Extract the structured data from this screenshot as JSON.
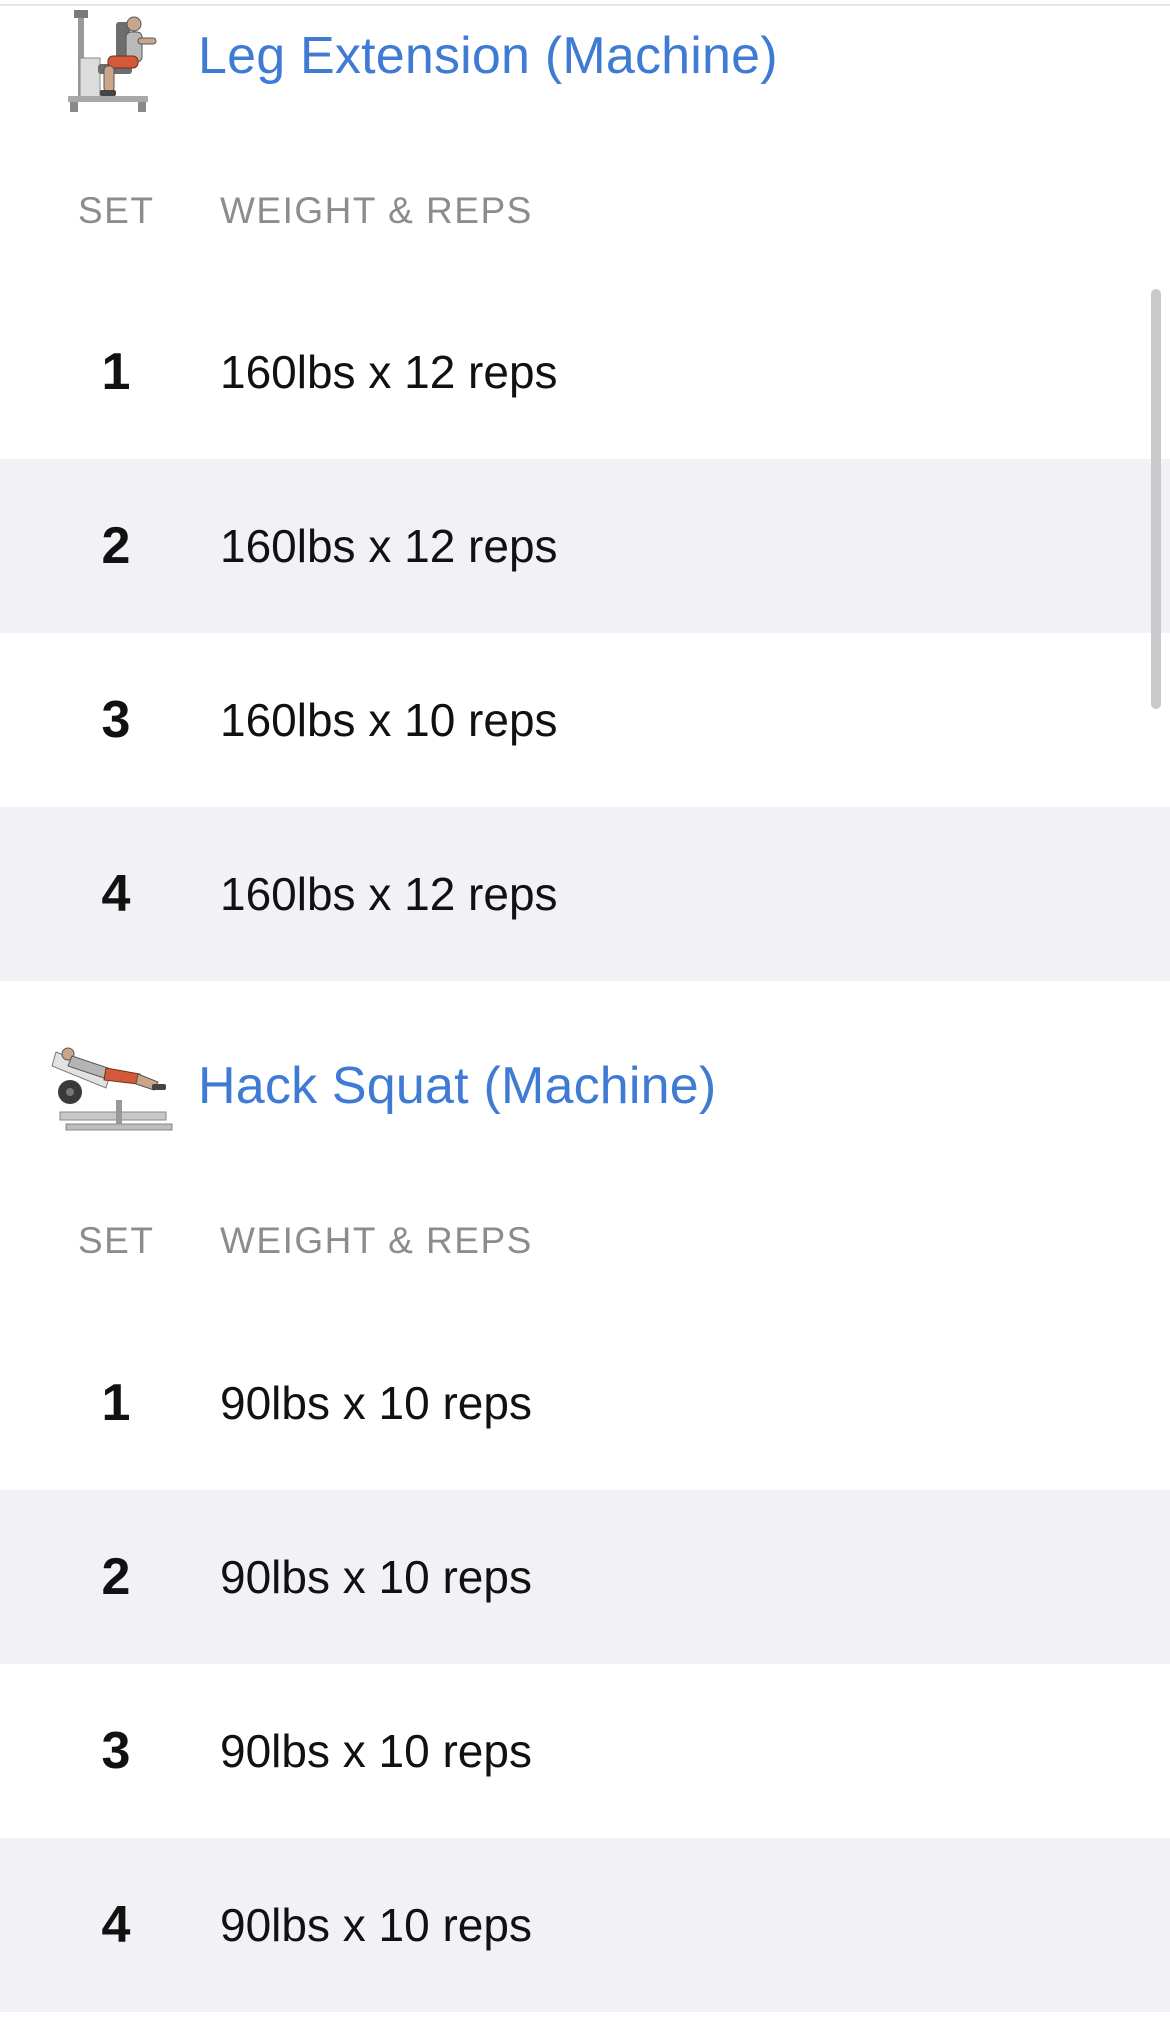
{
  "exercises": [
    {
      "name": "Leg Extension (Machine)",
      "thumbnail_icon": "leg-extension-machine-illustration",
      "columns": {
        "set": "SET",
        "weight_reps": "WEIGHT & REPS"
      },
      "sets": [
        {
          "set": "1",
          "value": "160lbs x 12 reps"
        },
        {
          "set": "2",
          "value": "160lbs x 12 reps"
        },
        {
          "set": "3",
          "value": "160lbs x 10 reps"
        },
        {
          "set": "4",
          "value": "160lbs x 12 reps"
        }
      ]
    },
    {
      "name": "Hack Squat (Machine)",
      "thumbnail_icon": "hack-squat-machine-illustration",
      "columns": {
        "set": "SET",
        "weight_reps": "WEIGHT & REPS"
      },
      "sets": [
        {
          "set": "1",
          "value": "90lbs x 10 reps"
        },
        {
          "set": "2",
          "value": "90lbs x 10 reps"
        },
        {
          "set": "3",
          "value": "90lbs x 10 reps"
        },
        {
          "set": "4",
          "value": "90lbs x 10 reps"
        }
      ]
    }
  ],
  "colors": {
    "title_blue": "#3f7ad4",
    "header_gray": "#8c8c90",
    "alt_row_bg": "#f2f2f6",
    "text_dark": "#111111"
  }
}
